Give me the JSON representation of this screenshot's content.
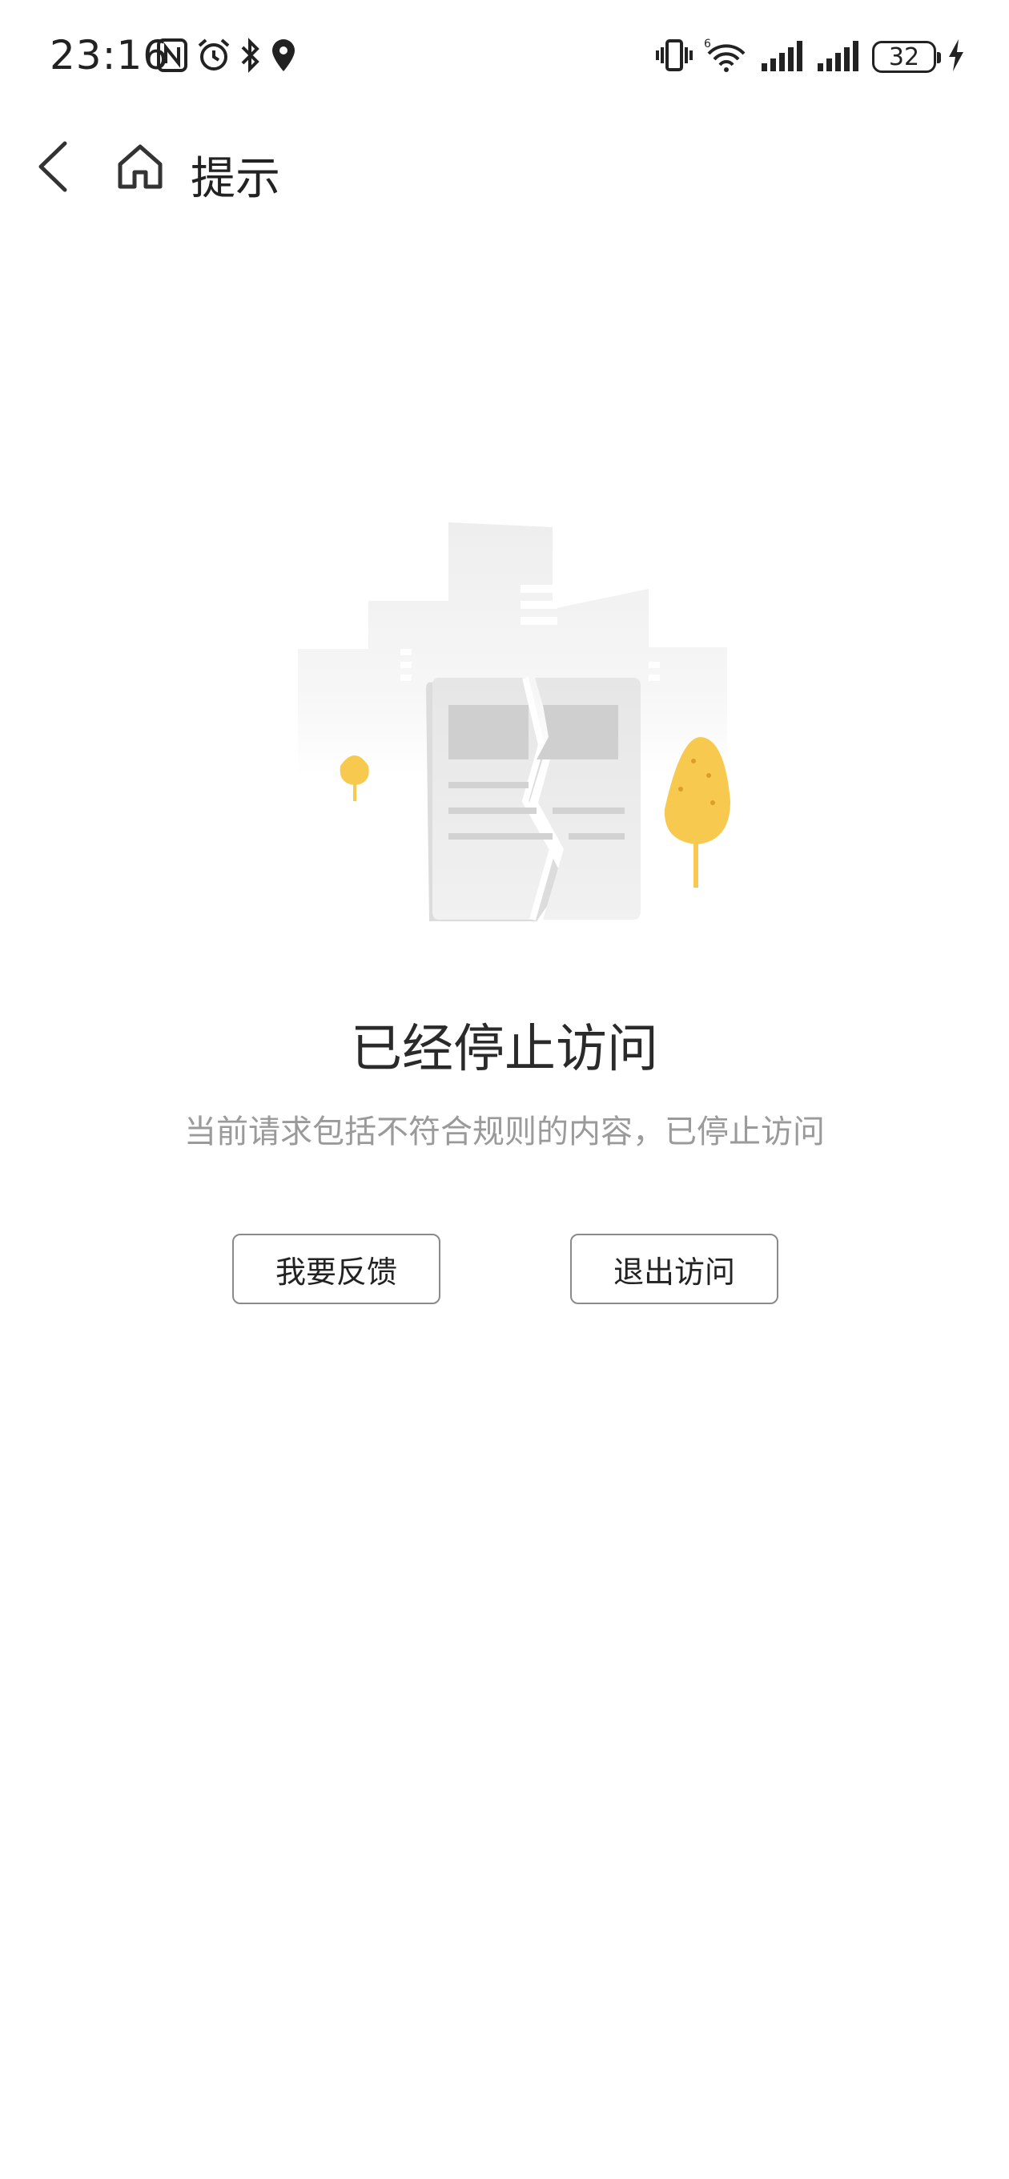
{
  "status_bar": {
    "time": "23:16",
    "battery": "32",
    "left_icons": [
      "nfc-icon",
      "alarm-icon",
      "bluetooth-icon",
      "location-icon"
    ],
    "right_icons": [
      "vibrate-icon",
      "wifi-6-icon",
      "signal-icon",
      "signal-icon",
      "battery-icon",
      "charging-icon"
    ]
  },
  "nav": {
    "title": "提示",
    "back_icon": "chevron-left-icon",
    "home_icon": "home-icon"
  },
  "content": {
    "illustration_icon": "broken-document-illustration",
    "title": "已经停止访问",
    "description": "当前请求包括不符合规则的内容，已停止访问"
  },
  "actions": {
    "feedback_label": "我要反馈",
    "exit_label": "退出访问"
  },
  "colors": {
    "accent_yellow": "#F7C94E",
    "text_primary": "#222222",
    "text_secondary": "#9A9A9A",
    "button_border": "#8A8A8A"
  }
}
